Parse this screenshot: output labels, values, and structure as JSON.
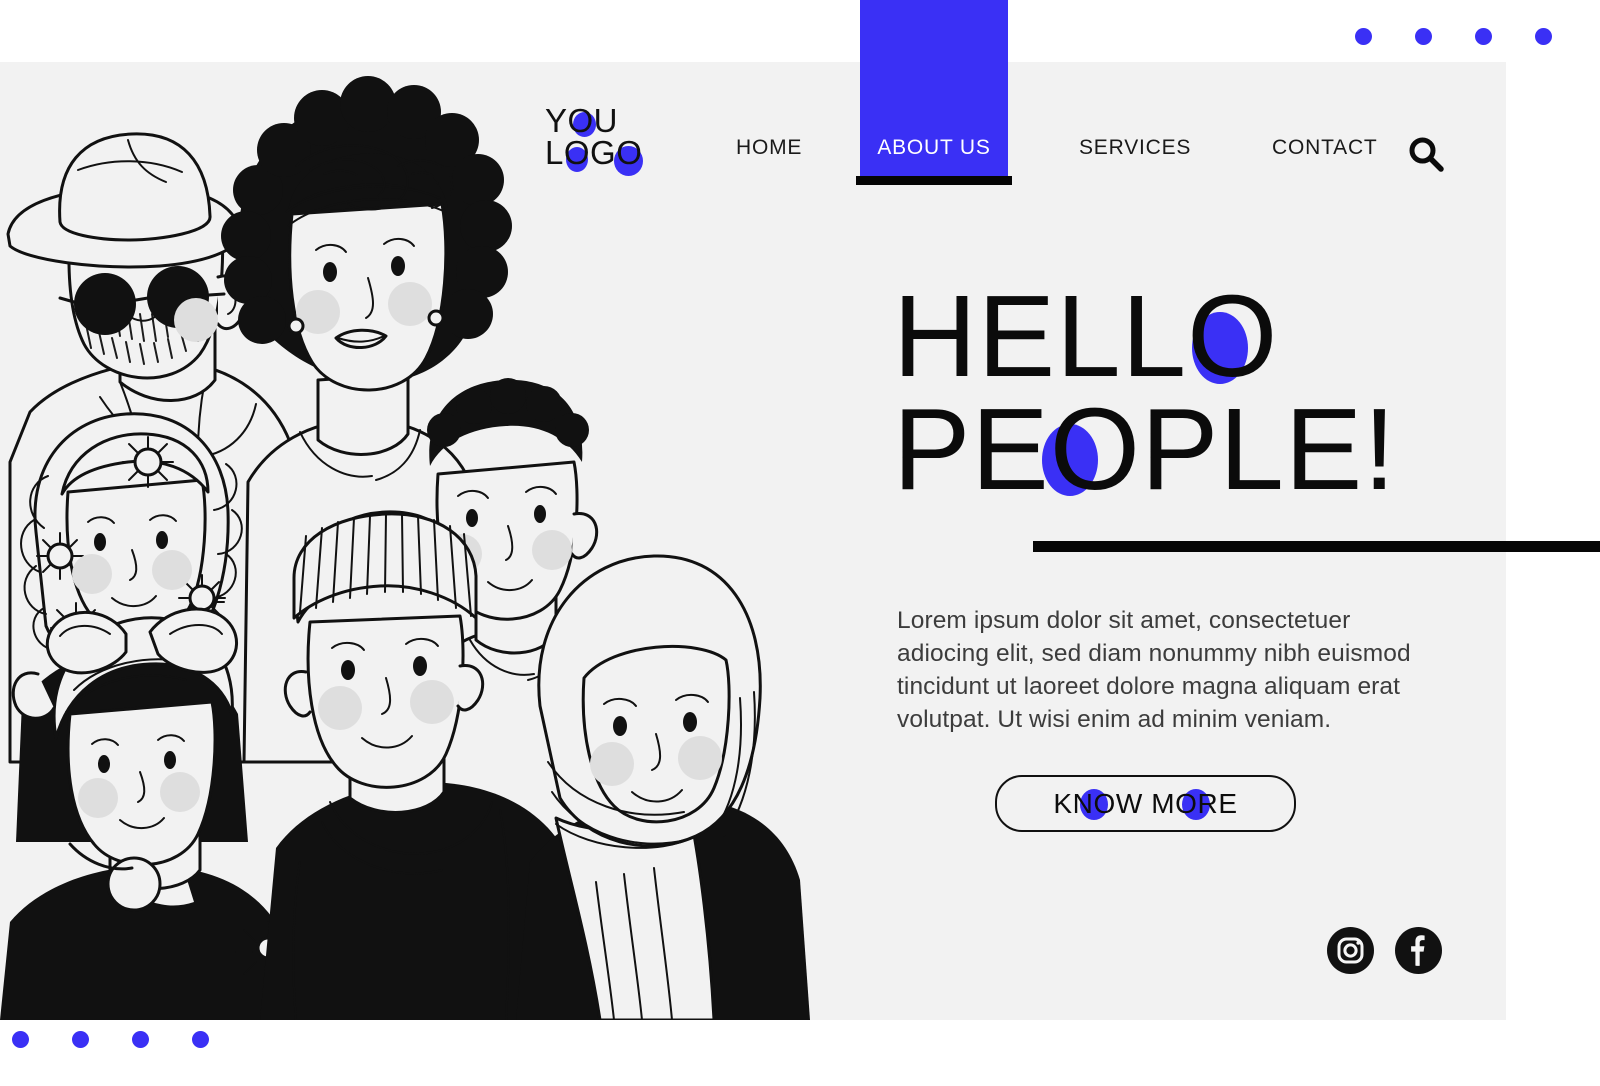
{
  "theme": {
    "accent_blue": "#3a30f5",
    "panel_bg": "#f2f2f2",
    "page_bg": "#ffffff",
    "ink": "#0b0b0b"
  },
  "brand": {
    "line1": "YOU",
    "line2": "LOGO"
  },
  "nav": {
    "items": [
      {
        "label": "HOME",
        "active": false
      },
      {
        "label": "ABOUT US",
        "active": true
      },
      {
        "label": "SERVICES",
        "active": false
      },
      {
        "label": "CONTACT",
        "active": false
      }
    ],
    "search_icon": "search-icon"
  },
  "hero": {
    "heading_line1": "HELLO",
    "heading_line2": "PEOPLE!",
    "paragraph": "Lorem ipsum dolor sit amet, consectetuer adiocing elit, sed diam nonummy nibh euismod tincidunt ut laoreet dolore magna aliquam erat volutpat. Ut wisi enim ad minim veniam.",
    "cta_label": "KNOW MORE"
  },
  "social": [
    {
      "name": "instagram-icon"
    },
    {
      "name": "facebook-icon"
    }
  ],
  "decor": {
    "top_dot_count": 4,
    "bottom_dot_count": 4,
    "dot_color": "#3a30f5"
  },
  "illustration": {
    "alt": "group of nine diverse people line illustration",
    "figures": [
      "man-with-hat-and-sunglasses",
      "woman-with-afro-and-headscarf",
      "woman-with-flowers-in-hair",
      "man-with-short-curly-hair",
      "woman-with-headwrap-and-hoop-earring",
      "man-with-beanie",
      "woman-with-hijab"
    ]
  }
}
